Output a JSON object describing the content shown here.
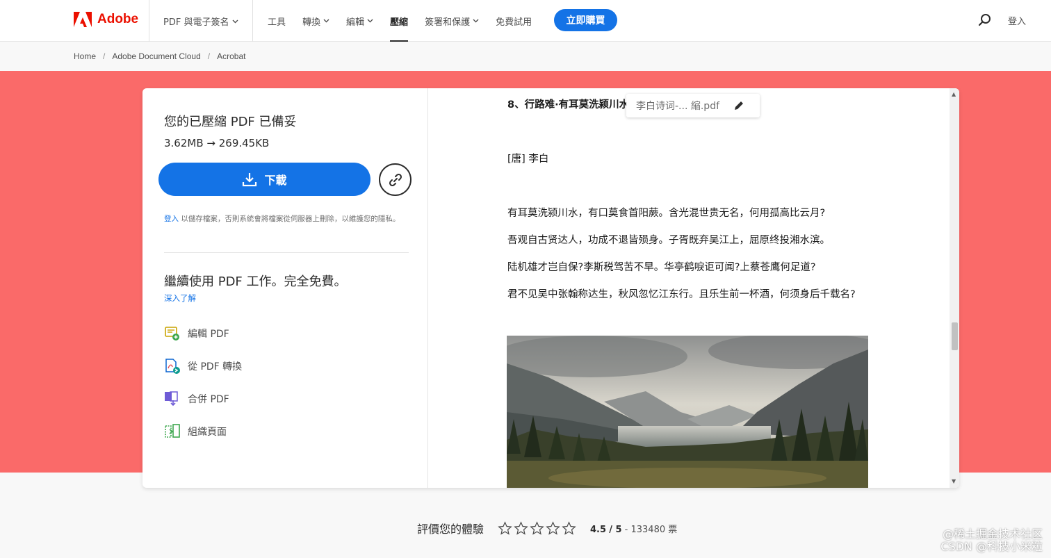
{
  "nav": {
    "brand": "Adobe",
    "product": "PDF 與電子簽名",
    "items": [
      {
        "label": "工具",
        "dropdown": false,
        "active": false
      },
      {
        "label": "轉換",
        "dropdown": true,
        "active": false
      },
      {
        "label": "編輯",
        "dropdown": true,
        "active": false
      },
      {
        "label": "壓縮",
        "dropdown": false,
        "active": true
      },
      {
        "label": "簽署和保護",
        "dropdown": true,
        "active": false
      },
      {
        "label": "免費試用",
        "dropdown": false,
        "active": false
      }
    ],
    "buy_label": "立即購買",
    "signin_label": "登入",
    "brand_color": "#eb1000",
    "accent_color": "#1473e6"
  },
  "breadcrumb": [
    "Home",
    "Adobe Document Cloud",
    "Acrobat"
  ],
  "result": {
    "title": "您的已壓縮 PDF 已備妥",
    "sizes": "3.62MB → 269.45KB",
    "download_label": "下載",
    "signin_link": "登入",
    "signin_note": " 以儲存檔案，否則系統會將檔案從伺服器上刪除，以維護您的隱私。",
    "continue_title": "繼續使用 PDF 工作。完全免費。",
    "learn_more": "深入了解",
    "tools": [
      {
        "icon": "edit-pdf-icon",
        "label": "編輯 PDF"
      },
      {
        "icon": "convert-pdf-icon",
        "label": "從 PDF 轉換"
      },
      {
        "icon": "combine-pdf-icon",
        "label": "合併 PDF"
      },
      {
        "icon": "organize-pages-icon",
        "label": "組織頁面"
      }
    ]
  },
  "preview": {
    "filename": "李白诗词-... 縮.pdf",
    "heading": "8、行路难·有耳莫洗颍川水",
    "author": "[唐] 李白",
    "lines": [
      "有耳莫洗颍川水，有口莫食首阳蕨。含光混世贵无名，何用孤高比云月?",
      "吾观自古贤达人，功成不退皆殒身。子胥既弃吴江上，屈原终投湘水滨。",
      "陆机雄才岂自保?李斯税驾苦不早。华亭鹤唳讵可闻?上蔡苍鹰何足道?",
      "君不见吴中张翰称达生，秋风忽忆江东行。且乐生前一杯酒，何须身后千载名?"
    ]
  },
  "rating": {
    "label": "評價您的體驗",
    "score": "4.5",
    "max": "/ 5",
    "votes": "- 133480 票",
    "stars": 5
  },
  "watermark": {
    "line1": "@稀土掘金技术社区",
    "line2": "CSDN @科技小米粒"
  }
}
